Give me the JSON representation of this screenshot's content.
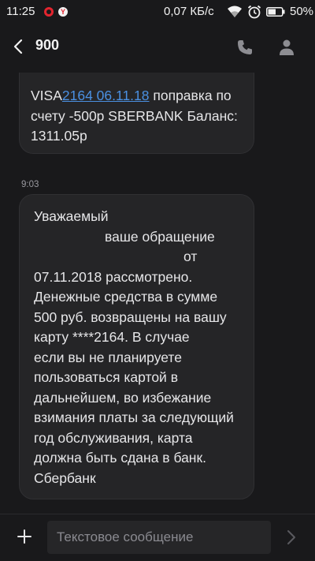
{
  "status_bar": {
    "time": "11:25",
    "notif_b_glyph": "Y",
    "network_speed": "0,07 КБ/с",
    "battery_percent": "50%"
  },
  "header": {
    "contact": "900",
    "icons": [
      "back-arrow-icon",
      "phone-icon",
      "person-icon"
    ]
  },
  "messages": [
    {
      "lines": [
        {
          "pre": "VISA",
          "link": "2164 06.11.18",
          "post": " поправка по"
        },
        {
          "pre": "счету -500р SBERBANK Баланс:"
        },
        {
          "pre": "1311.05р"
        }
      ]
    },
    {
      "time": "9:03",
      "lines": [
        "Уважаемый",
        "ваше обращение",
        "от",
        "07.11.2018 рассмотрено.",
        "Денежные средства в сумме",
        "500 руб. возвращены на вашу",
        "карту ****2164. В случае",
        "если вы не планируете",
        "пользоваться картой в",
        "дальнейшем, во избежание",
        "взимания платы за следующий",
        "год обслуживания, карта",
        "должна быть сдана в банк.",
        "Сбербанк"
      ]
    }
  ],
  "composer": {
    "placeholder": "Текстовое сообщение"
  },
  "colors": {
    "background": "#19191b",
    "bubble": "#252527",
    "link": "#4a90e2",
    "notification_red": "#e3252f"
  }
}
